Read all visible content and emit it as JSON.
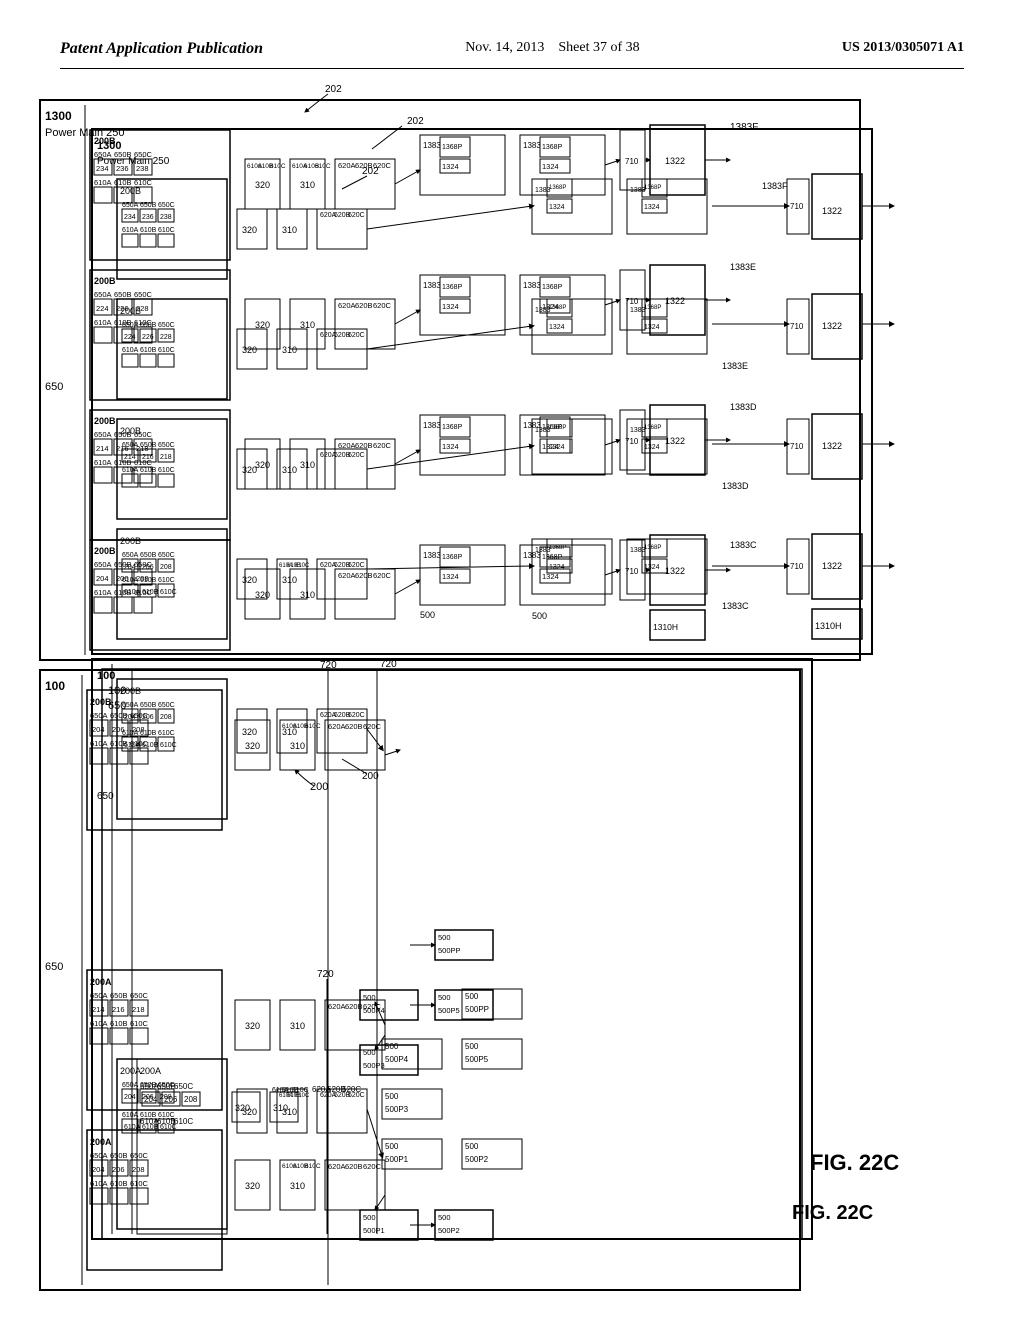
{
  "header": {
    "left": "Patent Application Publication",
    "center_date": "Nov. 14, 2013",
    "center_sheet": "Sheet 37 of 38",
    "right": "US 2013/0305071 A1"
  },
  "figure": {
    "label": "FIG. 22C"
  }
}
